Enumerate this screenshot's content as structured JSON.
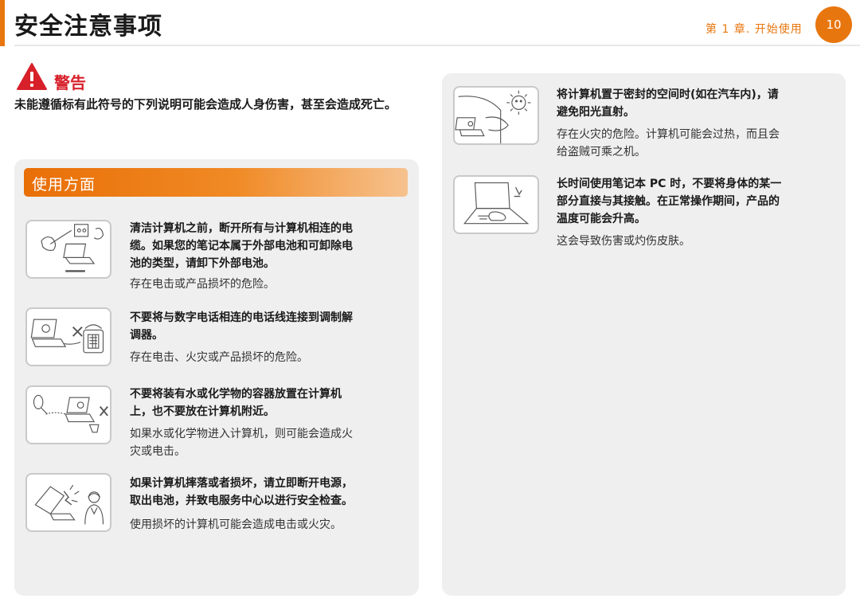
{
  "header": {
    "title": "安全注意事项",
    "chapter": "第 1 章. 开始使用",
    "page_number": "10",
    "accent_color": "#e8760e"
  },
  "warning": {
    "icon": "warning-triangle-icon",
    "label": "警告",
    "text": "未能遵循标有此符号的下列说明可能会造成人身伤害，甚至会造成死亡。"
  },
  "section": {
    "title": "使用方面"
  },
  "left_items": [
    {
      "icon": "unplug-cable-icon",
      "head_lines": [
        "清洁计算机之前，断开所有与计算机相连的电",
        "缆。如果您的笔记本属于外部电池和可卸除电",
        "池的类型，请卸下外部电池。"
      ],
      "body_lines": [
        "存在电击或产品损坏的危险。"
      ]
    },
    {
      "icon": "phone-line-icon",
      "head_lines": [
        "不要将与数字电话相连的电话线连接到调制解",
        "调器。"
      ],
      "body_lines": [
        "存在电击、火灾或产品损坏的危险。"
      ]
    },
    {
      "icon": "liquid-spill-icon",
      "head_lines": [
        "不要将装有水或化学物的容器放置在计算机",
        "上，也不要放在计算机附近。"
      ],
      "body_lines": [
        "如果水或化学物进入计算机，则可能会造成火",
        "灾或电击。"
      ]
    },
    {
      "icon": "broken-laptop-icon",
      "head_lines": [
        "如果计算机摔落或者损坏，请立即断开电源，",
        "取出电池，并致电服务中心以进行安全检查。"
      ],
      "body_lines": [
        "使用损坏的计算机可能会造成电击或火灾。"
      ]
    }
  ],
  "right_items": [
    {
      "icon": "sun-car-icon",
      "head_lines": [
        "将计算机置于密封的空间时(如在汽车内)，请",
        "避免阳光直射。"
      ],
      "body_lines": [
        "存在火灾的危险。计算机可能会过热，而且会",
        "给盗贼可乘之机。"
      ]
    },
    {
      "icon": "hot-laptop-icon",
      "head_lines": [
        "长时间使用笔记本 PC 时，不要将身体的某一",
        "部分直接与其接触。在正常操作期间，产品的",
        "温度可能会升高。"
      ],
      "body_lines": [
        "这会导致伤害或灼伤皮肤。"
      ]
    }
  ]
}
